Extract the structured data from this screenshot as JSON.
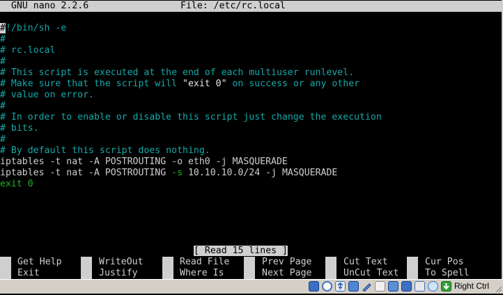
{
  "titlebar": {
    "app": "GNU nano 2.2.6",
    "file": "File: /etc/rc.local"
  },
  "file_lines": [
    {
      "cursor": "#",
      "rest": "!/bin/sh -e"
    },
    "#",
    "# rc.local",
    "#",
    "# This script is executed at the end of each multiuser runlevel.",
    {
      "a": "# Make sure that the script will ",
      "b": "\"exit 0\"",
      "c": " on success or any other"
    },
    "# value on error.",
    "#",
    "# In order to enable or disable this script just change the execution",
    "# bits.",
    "#",
    "# By default this script does nothing.",
    "iptables -t nat -A POSTROUTING -o eth0 -j MASQUERADE",
    {
      "a": "iptables -t nat -A POSTROUTING ",
      "b": "-s",
      "c": " 10.10.10.0/24 -j MASQUERADE"
    },
    "exit 0"
  ],
  "status_message": "[ Read 15 lines ]",
  "shortcuts_row1": [
    {
      "key": "^G",
      "label": "Get Help"
    },
    {
      "key": "^O",
      "label": "WriteOut"
    },
    {
      "key": "^R",
      "label": "Read File"
    },
    {
      "key": "^Y",
      "label": "Prev Page"
    },
    {
      "key": "^K",
      "label": "Cut Text"
    },
    {
      "key": "^C",
      "label": "Cur Pos"
    }
  ],
  "shortcuts_row2": [
    {
      "key": "^X",
      "label": "Exit"
    },
    {
      "key": "^J",
      "label": "Justify"
    },
    {
      "key": "^W",
      "label": "Where Is"
    },
    {
      "key": "^V",
      "label": "Next Page"
    },
    {
      "key": "^U",
      "label": "UnCut Text"
    },
    {
      "key": "^T",
      "label": "To Spell"
    }
  ],
  "vm_statusbar": {
    "host_key": "Right Ctrl",
    "icons": [
      "hard-disk-icon",
      "optical-drive-icon",
      "usb-icon",
      "shared-folders-icon",
      "display-icon",
      "video-capture-icon",
      "network-icon",
      "recording-icon",
      "mouse-integration-icon",
      "arrow-down-icon"
    ]
  },
  "colors": {
    "comment": "#17a8a8",
    "highlight": "#22b022",
    "text": "#cfcfcf",
    "bar": "#cfcfcf"
  }
}
